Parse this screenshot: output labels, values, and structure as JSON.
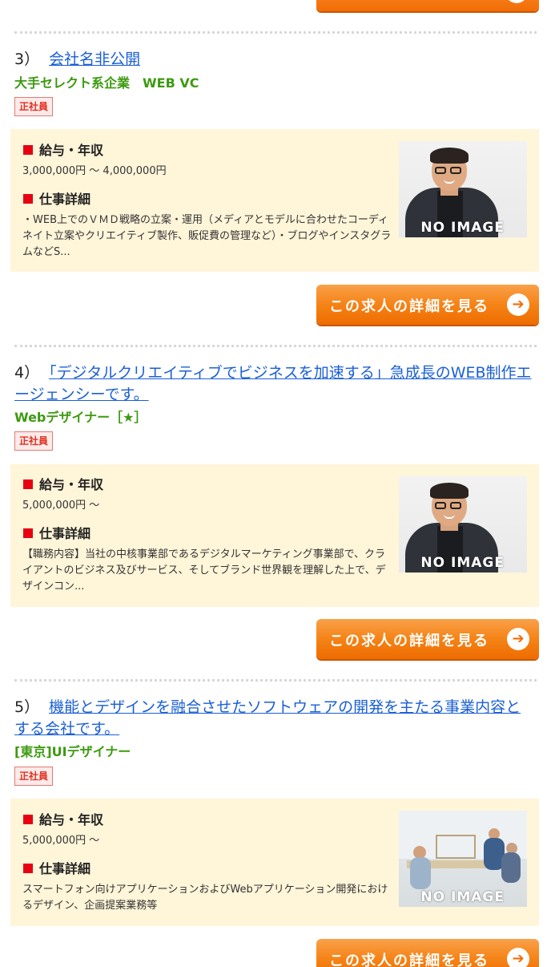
{
  "jobs": [
    {
      "number": "3）",
      "title": "会社名非公開",
      "subtitle": "大手セレクト系企業　WEB VC",
      "badge": "正社員",
      "salary_label": "給与・年収",
      "salary": "3,000,000円 〜 4,000,000円",
      "detail_label": "仕事詳細",
      "description": "・WEB上でのＶＭＤ戦略の立案・運用（メディアとモデルに合わせたコーディネイト立案やクリエイティブ製作、販促費の管理など）・ブログやインスタグラムなどS...",
      "image_overlay": "NO IMAGE",
      "image_kind": "person",
      "button_label": "この求人の詳細を見る"
    },
    {
      "number": "4）",
      "title": "「デジタルクリエイティブでビジネスを加速する」急成長のWEB制作エージェンシーです。",
      "subtitle": "Webデザイナー［★］",
      "badge": "正社員",
      "salary_label": "給与・年収",
      "salary": "5,000,000円 〜",
      "detail_label": "仕事詳細",
      "description": "【職務内容】当社の中核事業部であるデジタルマーケティング事業部で、クライアントのビジネス及びサービス、そしてブランド世界観を理解した上で、デザインコン...",
      "image_overlay": "NO IMAGE",
      "image_kind": "person",
      "button_label": "この求人の詳細を見る"
    },
    {
      "number": "5）",
      "title": "機能とデザインを融合させたソフトウェアの開発を主たる事業内容とする会社です。",
      "subtitle": "[東京]UIデザイナー",
      "badge": "正社員",
      "salary_label": "給与・年収",
      "salary": "5,000,000円 〜",
      "detail_label": "仕事詳細",
      "description": "スマートフォン向けアプリケーションおよびWebアプリケーション開発におけるデザイン、企画提案業務等",
      "image_overlay": "NO IMAGE",
      "image_kind": "office",
      "button_label": "この求人の詳細を見る"
    }
  ],
  "colors": {
    "link": "#1a5fd6",
    "subtitle": "#3d9a10",
    "badge_text": "#e0301e",
    "box_bg": "#fff5d9",
    "button": "#f58316",
    "square": "#e60012"
  },
  "icons": {
    "button_arrow": "arrow-right-circle-icon",
    "label_marker": "red-square-icon"
  }
}
